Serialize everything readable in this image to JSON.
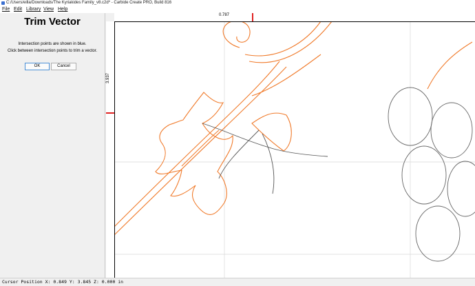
{
  "window": {
    "title": "C:/Users/eilla/Downloads/The Kyriakides Family_v8.c2d* - Carbide Create PRO, Build 816"
  },
  "menu": [
    {
      "label": "File"
    },
    {
      "label": "Edit"
    },
    {
      "label": "Library"
    },
    {
      "label": "View"
    },
    {
      "label": "Help"
    }
  ],
  "panel": {
    "heading": "Trim Vector",
    "info1": "Intersection points are shown in blue.",
    "info2": "Click between intersection points to trim a vector.",
    "ok_label": "OK",
    "cancel_label": "Cancel"
  },
  "rulers": {
    "top_value": "0.787",
    "left_value": "3.937"
  },
  "status": {
    "cursor": "Cursor Position X: 0.849 Y: 3.845 Z: 0.000 in"
  },
  "colors": {
    "vector": "#f07a2a",
    "selected": "#555555",
    "grid": "#d8d8d8",
    "marker": "#e02020"
  }
}
